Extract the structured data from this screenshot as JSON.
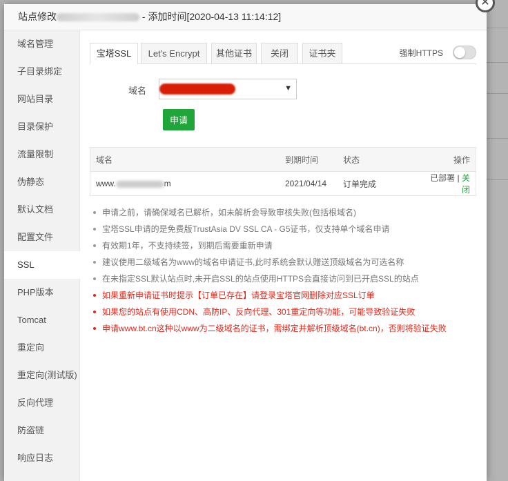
{
  "modal": {
    "title_prefix": "站点修改",
    "title_suffix": " - 添加时间[2020-04-13 11:14:12]"
  },
  "sidebar": {
    "items": [
      {
        "label": "域名管理"
      },
      {
        "label": "子目录绑定"
      },
      {
        "label": "网站目录"
      },
      {
        "label": "目录保护"
      },
      {
        "label": "流量限制"
      },
      {
        "label": "伪静态"
      },
      {
        "label": "默认文档"
      },
      {
        "label": "配置文件"
      },
      {
        "label": "SSL"
      },
      {
        "label": "PHP版本"
      },
      {
        "label": "Tomcat"
      },
      {
        "label": "重定向"
      },
      {
        "label": "重定向(测试版)"
      },
      {
        "label": "反向代理"
      },
      {
        "label": "防盗链"
      },
      {
        "label": "响应日志"
      }
    ],
    "active": "SSL"
  },
  "tabs": [
    {
      "label": "宝塔SSL"
    },
    {
      "label": "Let's Encrypt"
    },
    {
      "label": "其他证书"
    },
    {
      "label": "关闭"
    },
    {
      "label": "证书夹"
    }
  ],
  "force_https": {
    "label": "强制HTTPS",
    "enabled": false
  },
  "form": {
    "domain_label": "域名",
    "apply_button": "申请"
  },
  "table": {
    "headers": [
      "域名",
      "到期时间",
      "状态",
      "操作"
    ],
    "rows": [
      {
        "domain_prefix": "www.",
        "domain_suffix": "m",
        "expires": "2021/04/14",
        "status": "订单完成",
        "action_state": "已部署",
        "separator": " | ",
        "action_link": "关闭"
      }
    ]
  },
  "notes": [
    {
      "text": "申请之前，请确保域名已解析，如未解析会导致审核失败(包括根域名)",
      "warn": false
    },
    {
      "text": "宝塔SSL申请的是免费版TrustAsia DV SSL CA - G5证书，仅支持单个域名申请",
      "warn": false
    },
    {
      "text": "有效期1年，不支持续签，到期后需要重新申请",
      "warn": false
    },
    {
      "text": "建议使用二级域名为www的域名申请证书,此时系统会默认赠送顶级域名为可选名称",
      "warn": false
    },
    {
      "text": "在未指定SSL默认站点时,未开启SSL的站点使用HTTPS会直接访问到已开启SSL的站点",
      "warn": false
    },
    {
      "text": "如果重新申请证书时提示【订单已存在】请登录宝塔官网删除对应SSL订单",
      "warn": true
    },
    {
      "text": "如果您的站点有使用CDN、高防IP、反向代理、301重定向等功能，可能导致验证失败",
      "warn": true
    },
    {
      "text": "申请www.bt.cn这种以www为二级域名的证书，需绑定并解析顶级域名(bt.cn)，否则将验证失败",
      "warn": true
    }
  ],
  "colors": {
    "accent": "#20a53a",
    "warn": "#e0271a"
  }
}
